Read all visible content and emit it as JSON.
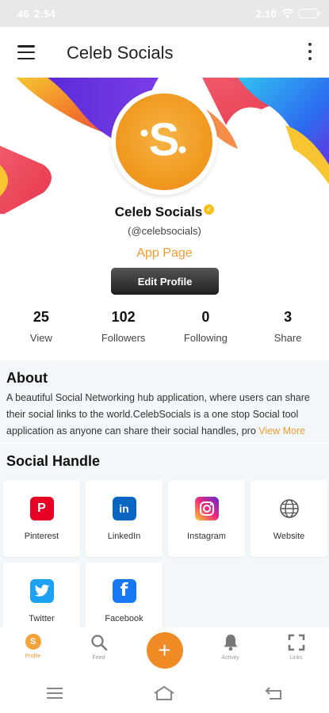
{
  "status_bar": {
    "time": "2:54",
    "signal": "46",
    "speed": "2.10"
  },
  "app_bar": {
    "title": "Celeb Socials"
  },
  "profile": {
    "name": "Celeb Socials",
    "handle": "(@celebsocials)",
    "page_type": "App Page",
    "edit_label": "Edit Profile",
    "avatar_letter": "S"
  },
  "stats": [
    {
      "value": "25",
      "label": "View"
    },
    {
      "value": "102",
      "label": "Followers"
    },
    {
      "value": "0",
      "label": "Following"
    },
    {
      "value": "3",
      "label": "Share"
    }
  ],
  "about": {
    "title": "About",
    "text": "A beautiful Social Networking hub application, where users can share their social links to the world.CelebSocials is a one stop Social tool application as anyone can share their social handles, pro",
    "view_more": "View More"
  },
  "social": {
    "title": "Social Handle",
    "items": [
      {
        "label": "Pinterest",
        "icon": "pinterest-icon",
        "color": "#e60023"
      },
      {
        "label": "LinkedIn",
        "icon": "linkedin-icon",
        "color": "#0a66c2"
      },
      {
        "label": "Instagram",
        "icon": "instagram-icon",
        "color": "#d62976"
      },
      {
        "label": "Website",
        "icon": "globe-icon",
        "color": "#555555"
      },
      {
        "label": "Twitter",
        "icon": "twitter-icon",
        "color": "#1da1f2"
      },
      {
        "label": "Facebook",
        "icon": "facebook-icon",
        "color": "#1877f2"
      }
    ]
  },
  "bottom_nav": [
    {
      "label": "Profile",
      "icon": "profile-avatar-icon"
    },
    {
      "label": "Feed",
      "icon": "search-icon"
    },
    {
      "label": "",
      "icon": "add-icon"
    },
    {
      "label": "Activity",
      "icon": "bell-icon"
    },
    {
      "label": "Links",
      "icon": "expand-icon"
    }
  ],
  "colors": {
    "accent": "#f29a2e",
    "fab": "#f08a24",
    "section_bg": "#f2f7f9"
  }
}
